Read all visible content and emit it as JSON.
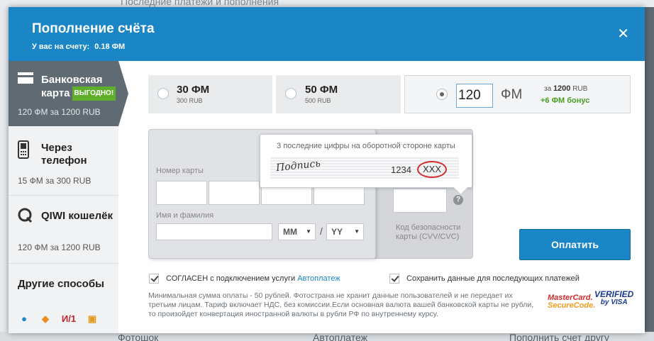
{
  "background": {
    "top_text": "Последние платежи и пополнения",
    "bottom_items": [
      "Фотошок",
      "Автоплатеж",
      "Пополнить счет другу"
    ]
  },
  "modal": {
    "title": "Пополнение счёта",
    "balance_label": "У вас на счету:",
    "balance_value": "0.18 ФМ",
    "close_icon": "close-icon"
  },
  "sidebar": {
    "items": [
      {
        "title_line1": "Банковская",
        "title_line2": "карта",
        "badge": "ВЫГОДНО!",
        "sub": "120 ФМ за 1200 RUB",
        "icon": "bank-card-icon",
        "active": true
      },
      {
        "title_line1": "Через",
        "title_line2": "телефон",
        "sub": "15 ФМ за 300 RUB",
        "icon": "phone-icon"
      },
      {
        "title_line1": "QIWI кошелёк",
        "sub": "120 ФМ за 1200 RUB",
        "icon": "qiwi-icon"
      },
      {
        "title_line1": "Другие способы"
      }
    ],
    "payment_icons": [
      "webmoney-icon",
      "yandex-money-icon",
      "moneta-icon",
      "wallet-icon"
    ]
  },
  "amounts": [
    {
      "value": "30 ФМ",
      "price": "300 RUB"
    },
    {
      "value": "50 ФМ",
      "price": "500 RUB"
    }
  ],
  "custom_amount": {
    "input_value": "120",
    "unit": "ФМ",
    "for_label": "за",
    "price_value": "1200",
    "price_currency": "RUB",
    "bonus": "+6 ФМ бонус"
  },
  "card_form": {
    "number_label": "Номер карты",
    "name_label": "Имя и фамилия",
    "month_select": "MM",
    "year_select": "YY",
    "slash": "/",
    "cvv_label": "Код безопасности карты (CVV/CVC)",
    "help_icon": "?"
  },
  "tooltip": {
    "text": "3 последние цифры на оборотной стороне карты",
    "signature": "Подпись",
    "digits": "1234",
    "cvv_placeholder": "XXX"
  },
  "pay_button": "Оплатить",
  "checkboxes": {
    "autopay_text": "СОГЛАСЕН с подключением услуги",
    "autopay_link": "Автоплатеж",
    "save_text": "Сохранить данные для последующих платежей"
  },
  "disclaimer": "Минимальная сумма оплаты - 50 рублей. Фотострана не хранит данные пользователей и не передает их третьим лицам. Тариф включает НДС, без комиссии.Если основная валюта вашей банковской карты не рубли, то произойдет конвертация иностранной валюты в рубли РФ по внутреннему курсу.",
  "logos": {
    "mastercard_line1": "MasterCard.",
    "mastercard_line2": "SecureCode.",
    "visa_line1": "VERIFIED",
    "visa_line2": "by VISA"
  },
  "colors": {
    "accent": "#1b86c6",
    "sidebar_active": "#5f6a73",
    "bonus": "#4a9e23",
    "badge": "#5fae2c"
  }
}
